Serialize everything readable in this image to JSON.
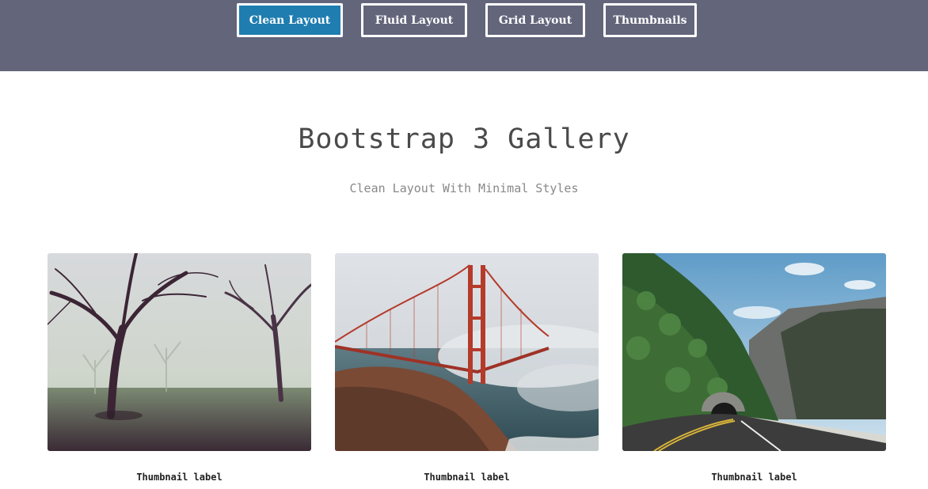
{
  "nav": {
    "buttons": [
      {
        "label": "Clean Layout",
        "active": true
      },
      {
        "label": "Fluid Layout",
        "active": false
      },
      {
        "label": "Grid Layout",
        "active": false
      },
      {
        "label": "Thumbnails",
        "active": false
      }
    ]
  },
  "header": {
    "title": "Bootstrap 3 Gallery",
    "subtitle": "Clean Layout With Minimal Styles"
  },
  "gallery": {
    "items": [
      {
        "caption": "Thumbnail label",
        "image": "foggy-trees-photo"
      },
      {
        "caption": "Thumbnail label",
        "image": "golden-gate-bridge-photo"
      },
      {
        "caption": "Thumbnail label",
        "image": "mountain-road-tunnel-photo"
      }
    ]
  },
  "colors": {
    "topbar": "#63657b",
    "active_button": "#1f7db0",
    "title_text": "#4a4a4a",
    "subtitle_text": "#888888"
  }
}
